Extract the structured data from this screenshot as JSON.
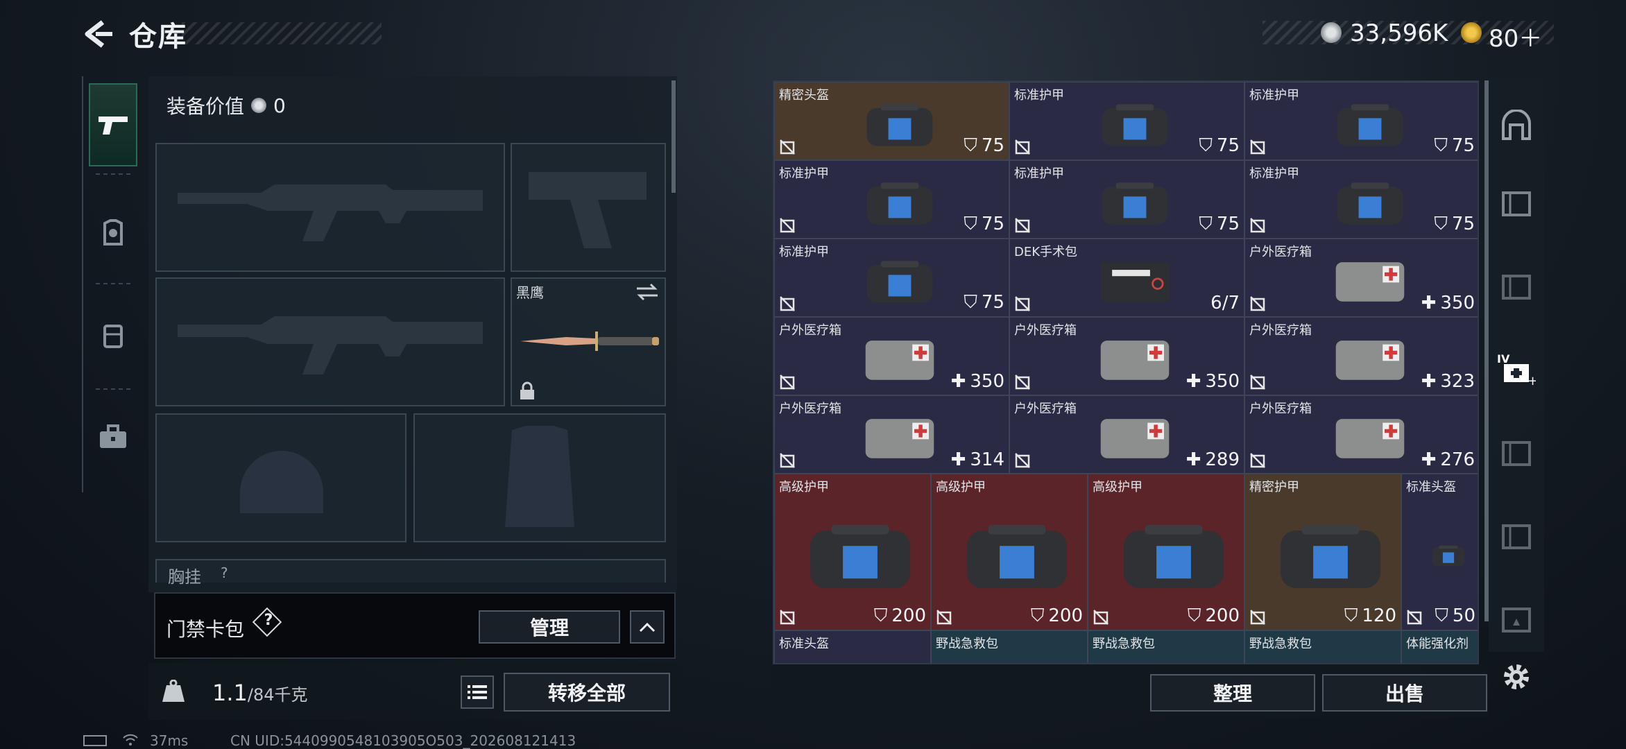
{
  "header": {
    "title": "仓库",
    "currency_silver": "33,596K",
    "currency_gold": "80＋"
  },
  "loadout": {
    "equip_value_label": "装备价值",
    "equip_value": "0",
    "knife_name": "黑鹰",
    "chest_label": "胸挂",
    "chest_hint": "?"
  },
  "keycard": {
    "label": "门禁卡包",
    "hint": "?",
    "manage": "管理"
  },
  "weight": {
    "value": "1.1",
    "max": "/84千克",
    "transfer_all": "转移全部"
  },
  "actions": {
    "sort": "整理",
    "sell": "出售"
  },
  "status": {
    "ping": "37ms",
    "uid": "CN UID:5440990548103905O503_202608121413"
  },
  "colors": {
    "blue_bg": "#2a2a44",
    "gold_bg": "#4a3a2c",
    "red_bg": "#5a2428",
    "teal_bg": "#1f3a46"
  },
  "items": [
    {
      "name": "精密头盔",
      "value": "75",
      "kind": "armor",
      "rarity": "gold"
    },
    {
      "name": "标准护甲",
      "value": "75",
      "kind": "armor",
      "rarity": "blue"
    },
    {
      "name": "标准护甲",
      "value": "75",
      "kind": "armor",
      "rarity": "blue"
    },
    {
      "name": "标准护甲",
      "value": "75",
      "kind": "armor",
      "rarity": "blue"
    },
    {
      "name": "标准护甲",
      "value": "75",
      "kind": "armor",
      "rarity": "blue"
    },
    {
      "name": "标准护甲",
      "value": "75",
      "kind": "armor",
      "rarity": "blue"
    },
    {
      "name": "标准护甲",
      "value": "75",
      "kind": "armor",
      "rarity": "blue"
    },
    {
      "name": "DEK手术包",
      "value": "6/7",
      "kind": "count",
      "rarity": "blue"
    },
    {
      "name": "户外医疗箱",
      "value": "350",
      "kind": "heal",
      "rarity": "blue"
    },
    {
      "name": "户外医疗箱",
      "value": "350",
      "kind": "heal",
      "rarity": "blue"
    },
    {
      "name": "户外医疗箱",
      "value": "350",
      "kind": "heal",
      "rarity": "blue"
    },
    {
      "name": "户外医疗箱",
      "value": "323",
      "kind": "heal",
      "rarity": "blue"
    },
    {
      "name": "户外医疗箱",
      "value": "314",
      "kind": "heal",
      "rarity": "blue"
    },
    {
      "name": "户外医疗箱",
      "value": "289",
      "kind": "heal",
      "rarity": "blue"
    },
    {
      "name": "户外医疗箱",
      "value": "276",
      "kind": "heal",
      "rarity": "blue"
    },
    {
      "name": "高级护甲",
      "value": "200",
      "kind": "armor",
      "rarity": "red"
    },
    {
      "name": "高级护甲",
      "value": "200",
      "kind": "armor",
      "rarity": "red"
    },
    {
      "name": "高级护甲",
      "value": "200",
      "kind": "armor",
      "rarity": "red"
    },
    {
      "name": "精密护甲",
      "value": "120",
      "kind": "armor",
      "rarity": "gold"
    },
    {
      "name": "标准头盔",
      "value": "50",
      "kind": "armor",
      "rarity": "blue"
    },
    {
      "name": "标准头盔",
      "value": "",
      "kind": "none",
      "rarity": "blue"
    },
    {
      "name": "野战急救包",
      "value": "",
      "kind": "none",
      "rarity": "teal"
    },
    {
      "name": "野战急救包",
      "value": "",
      "kind": "none",
      "rarity": "teal"
    },
    {
      "name": "野战急救包",
      "value": "",
      "kind": "none",
      "rarity": "teal"
    },
    {
      "name": "体能强化剂",
      "value": "",
      "kind": "none",
      "rarity": "teal"
    }
  ]
}
